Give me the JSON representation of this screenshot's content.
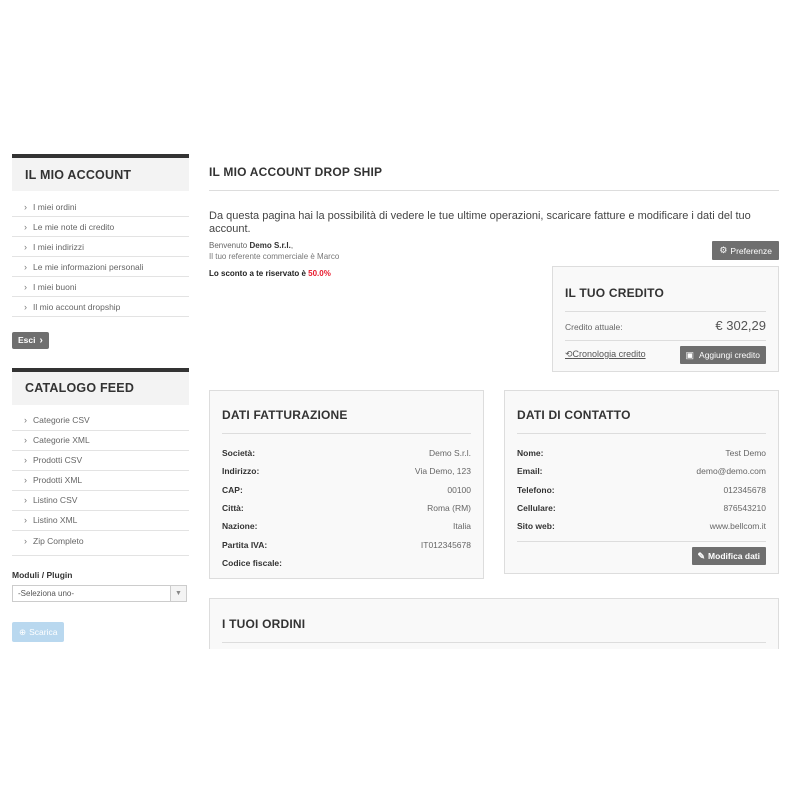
{
  "sidebar": {
    "account_title": "IL MIO ACCOUNT",
    "account_items": [
      {
        "label": "I miei ordini"
      },
      {
        "label": "Le mie note di credito"
      },
      {
        "label": "I miei indirizzi"
      },
      {
        "label": "Le mie informazioni personali"
      },
      {
        "label": "I miei buoni"
      },
      {
        "label": "Il mio account dropship"
      }
    ],
    "esci_label": "Esci",
    "feed_title": "CATALOGO FEED",
    "feed_items": [
      {
        "label": "Categorie CSV"
      },
      {
        "label": "Categorie XML"
      },
      {
        "label": "Prodotti CSV"
      },
      {
        "label": "Prodotti XML"
      },
      {
        "label": "Listino CSV"
      },
      {
        "label": "Listino XML"
      },
      {
        "label": "Zip Completo"
      }
    ],
    "moduli_label": "Moduli / Plugin",
    "select_value": "-Seleziona uno-",
    "scarica_label": "Scarica"
  },
  "main": {
    "title": "IL MIO ACCOUNT DROP SHIP",
    "intro": "Da questa pagina hai la possibilità di vedere le tue ultime operazioni, scaricare fatture e modificare i dati del tuo account.",
    "welcome_prefix": "Benvenuto",
    "welcome_name": "Demo S.r.l.",
    "welcome_suffix": ",",
    "referente": "Il tuo referente commerciale è Marco",
    "sconto_text": "Lo sconto a te riservato è",
    "sconto_value": "50.0%",
    "preferenze_label": "Preferenze"
  },
  "credito": {
    "title": "IL TUO CREDITO",
    "label": "Credito attuale:",
    "amount": "€ 302,29",
    "history_link": "Cronologia credito",
    "add_label": "Aggiungi credito"
  },
  "fatturazione": {
    "title": "DATI FATTURAZIONE",
    "rows": [
      {
        "k": "Società:",
        "v": "Demo S.r.l."
      },
      {
        "k": "Indirizzo:",
        "v": "Via Demo, 123"
      },
      {
        "k": "CAP:",
        "v": "00100"
      },
      {
        "k": "Città:",
        "v": "Roma (RM)"
      },
      {
        "k": "Nazione:",
        "v": "Italia"
      },
      {
        "k": "Partita IVA:",
        "v": "IT012345678"
      },
      {
        "k": "Codice fiscale:",
        "v": ""
      }
    ]
  },
  "contatto": {
    "title": "DATI DI CONTATTO",
    "rows": [
      {
        "k": "Nome:",
        "v": "Test Demo"
      },
      {
        "k": "Email:",
        "v": "demo@demo.com"
      },
      {
        "k": "Telefono:",
        "v": "012345678"
      },
      {
        "k": "Cellulare:",
        "v": "876543210"
      },
      {
        "k": "Sito web:",
        "v": "www.bellcom.it"
      }
    ],
    "modifica_label": "Modifica dati"
  },
  "ordini": {
    "title": "I TUOI ORDINI"
  },
  "icons": {
    "chevron": "chevron-right-icon",
    "preferenze": "gears-icon",
    "history": "history-icon",
    "add": "money-icon",
    "edit": "pencil-icon",
    "download": "download-icon"
  },
  "colors": {
    "accent_red": "#e8192c",
    "button_dark": "#6f6f6f",
    "button_light": "#b9d8ef"
  }
}
